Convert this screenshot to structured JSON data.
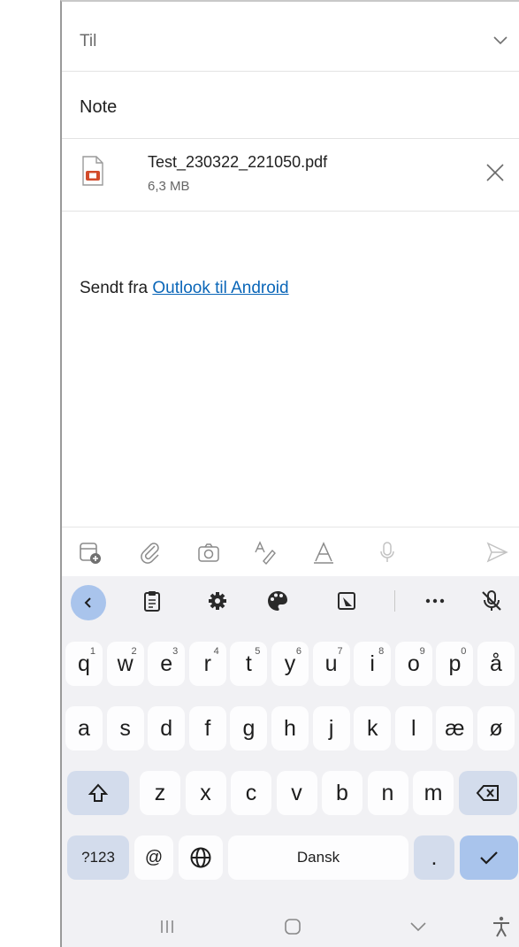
{
  "compose": {
    "to_label": "Til",
    "subject": "Note",
    "attachment": {
      "name": "Test_230322_221050.pdf",
      "size": "6,3 MB"
    },
    "signature_prefix": "Sendt fra ",
    "signature_link": "Outlook til Android"
  },
  "toolbar": {
    "icons": [
      "add-attachment-icon",
      "paperclip-icon",
      "camera-icon",
      "format-text-icon",
      "draw-icon",
      "microphone-icon",
      "send-icon"
    ]
  },
  "keyboard": {
    "top_icons": [
      "back-icon",
      "clipboard-icon",
      "gear-icon",
      "palette-icon",
      "resize-icon",
      "more-icon",
      "mic-off-icon"
    ],
    "row1": [
      {
        "k": "q",
        "s": "1"
      },
      {
        "k": "w",
        "s": "2"
      },
      {
        "k": "e",
        "s": "3"
      },
      {
        "k": "r",
        "s": "4"
      },
      {
        "k": "t",
        "s": "5"
      },
      {
        "k": "y",
        "s": "6"
      },
      {
        "k": "u",
        "s": "7"
      },
      {
        "k": "i",
        "s": "8"
      },
      {
        "k": "o",
        "s": "9"
      },
      {
        "k": "p",
        "s": "0"
      },
      {
        "k": "å",
        "s": ""
      }
    ],
    "row2": [
      "a",
      "s",
      "d",
      "f",
      "g",
      "h",
      "j",
      "k",
      "l",
      "æ",
      "ø"
    ],
    "row3": [
      "z",
      "x",
      "c",
      "v",
      "b",
      "n",
      "m"
    ],
    "mode_key": "?123",
    "at_key": "@",
    "space_label": "Dansk",
    "period_key": "."
  },
  "colors": {
    "accent": "#a9c4ec",
    "link": "#0a66b8",
    "pdf_red": "#d24b2a"
  }
}
